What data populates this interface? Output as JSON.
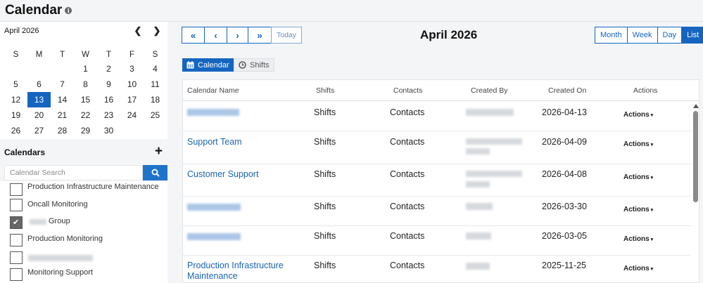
{
  "page": {
    "title": "Calendar"
  },
  "mini_calendar": {
    "month_label": "April 2026",
    "weekdays": [
      "S",
      "M",
      "T",
      "W",
      "T",
      "F",
      "S"
    ],
    "weeks": [
      [
        "",
        "",
        "",
        "1",
        "2",
        "3",
        "4"
      ],
      [
        "5",
        "6",
        "7",
        "8",
        "9",
        "10",
        "11"
      ],
      [
        "12",
        "13",
        "14",
        "15",
        "16",
        "17",
        "18"
      ],
      [
        "19",
        "20",
        "21",
        "22",
        "23",
        "24",
        "25"
      ],
      [
        "26",
        "27",
        "28",
        "29",
        "30",
        "",
        ""
      ]
    ],
    "today": "13"
  },
  "calendars_panel": {
    "title": "Calendars",
    "search_placeholder": "Calendar Search",
    "items": [
      {
        "label": "Production Infrastructure Maintenance",
        "checked": false
      },
      {
        "label": "Oncall Monitoring",
        "checked": false
      },
      {
        "label": "Group",
        "checked": true
      },
      {
        "label": "Production Monitoring",
        "checked": false
      },
      {
        "label": "",
        "checked": false
      },
      {
        "label": "Monitoring Support",
        "checked": false
      }
    ]
  },
  "toolbar": {
    "first_label": "«",
    "prev_label": "‹",
    "next_label": "›",
    "last_label": "»",
    "today_label": "Today",
    "title": "April 2026",
    "views": [
      {
        "label": "Month",
        "active": false
      },
      {
        "label": "Week",
        "active": false
      },
      {
        "label": "Day",
        "active": false
      },
      {
        "label": "List",
        "active": true
      }
    ]
  },
  "sub_tabs": {
    "calendar_label": "Calendar",
    "shifts_label": "Shifts"
  },
  "table": {
    "columns": [
      "Calendar Name",
      "Shifts",
      "Contacts",
      "Created By",
      "Created On",
      "Actions"
    ],
    "rows": [
      {
        "name": "",
        "shifts": "Shifts",
        "contacts": "Contacts",
        "created_on": "2026-04-13",
        "actions": "Actions"
      },
      {
        "name": "Support Team",
        "shifts": "Shifts",
        "contacts": "Contacts",
        "created_on": "2026-04-09",
        "actions": "Actions"
      },
      {
        "name": "Customer Support",
        "shifts": "Shifts",
        "contacts": "Contacts",
        "created_on": "2026-04-08",
        "actions": "Actions"
      },
      {
        "name": "",
        "shifts": "Shifts",
        "contacts": "Contacts",
        "created_on": "2026-03-30",
        "actions": "Actions"
      },
      {
        "name": "",
        "shifts": "Shifts",
        "contacts": "Contacts",
        "created_on": "2026-03-05",
        "actions": "Actions"
      },
      {
        "name": "Production Infrastructure Maintenance",
        "shifts": "Shifts",
        "contacts": "Contacts",
        "created_on": "2025-11-25",
        "actions": "Actions"
      }
    ]
  },
  "colors": {
    "accent": "#1565c0",
    "link": "#1a64b5",
    "check": "#666666"
  },
  "icons": [
    "info-icon",
    "chevron-left-icon",
    "chevron-right-icon",
    "plus-icon",
    "search-icon",
    "calendar-icon",
    "clock-icon",
    "caret-down-icon",
    "scroll-up-icon"
  ]
}
